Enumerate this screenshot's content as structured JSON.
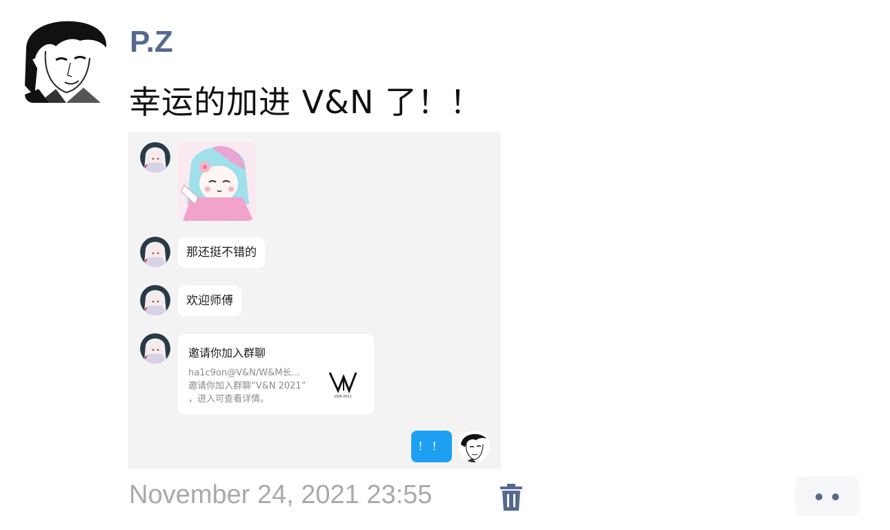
{
  "post": {
    "author": "P.Z",
    "text": "幸运的加进 V&N 了！！",
    "timestamp": "November 24, 2021 23:55"
  },
  "screenshot": {
    "messages": [
      {
        "type": "sticker",
        "from": "other"
      },
      {
        "type": "text",
        "from": "other",
        "text": "那还挺不错的"
      },
      {
        "type": "text",
        "from": "other",
        "text": "欢迎师傅"
      },
      {
        "type": "group-invite",
        "from": "other",
        "title": "邀请你加入群聊",
        "line1": "ha1c9on@V&N/W&M长...",
        "line2": "邀请你加入群聊“V&N 2021”",
        "line3": "，进入可查看详情。",
        "logo_caption": "V&N 2021"
      },
      {
        "type": "text",
        "from": "me",
        "text": "！！"
      }
    ]
  },
  "icons": {
    "delete": "trash-icon",
    "more": "more-dots-icon"
  },
  "colors": {
    "author": "#56698f",
    "my_bubble": "#1ea0f2",
    "screenshot_bg": "#f3f3f4",
    "timestamp": "#a9a9a9"
  }
}
